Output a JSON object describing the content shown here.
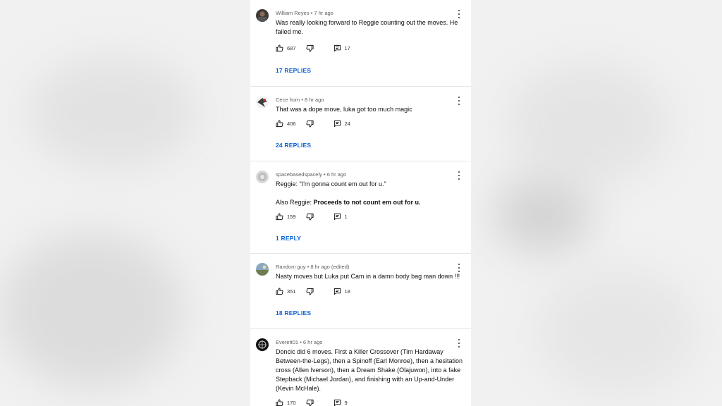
{
  "comments": [
    {
      "author": "William Reyes",
      "time": "7 hr ago",
      "text": [
        "Was really looking forward to Reggie counting out the moves. He failed me."
      ],
      "likes": "687",
      "reply_count": "17",
      "replies_label": "17 REPLIES"
    },
    {
      "author": "Cece hom",
      "time": "8 hr ago",
      "text": [
        "That was a dope move, luka got too much magic"
      ],
      "likes": "406",
      "reply_count": "24",
      "replies_label": "24 REPLIES"
    },
    {
      "author": "spacebasedspacely",
      "time": "6 hr ago",
      "text": [
        "Reggie: \"I'm gonna count em out for u.\""
      ],
      "text2_prefix": "Also Reggie: ",
      "text2_bold": "Proceeds to not count em out for u.",
      "likes": "159",
      "reply_count": "1",
      "replies_label": "1 REPLY"
    },
    {
      "author": "Random guy",
      "time": "8 hr ago (edited)",
      "text": [
        "Nasty moves but Luka put Cam in a damn body bag man down !!!"
      ],
      "likes": "351",
      "reply_count": "18",
      "replies_label": "18 REPLIES"
    },
    {
      "author": "Everett01",
      "time": "6 hr ago",
      "text": [
        "Doncic did 6 moves. First a Killer Crossover (Tim Hardaway Between-the-Legs), then a Spinoff (Earl Monroe), then a hesitation cross (Allen Iverson), then a Dream Shake (Olajuwon), into a fake Stepback (Michael Jordan), and finishing with an Up-and-Under (Kevin McHale)."
      ],
      "likes": "170",
      "reply_count": "9"
    }
  ],
  "meta_separator": " • ",
  "colors": {
    "link": "#065fd4",
    "text": "#0f0f0f",
    "meta": "#606060"
  }
}
